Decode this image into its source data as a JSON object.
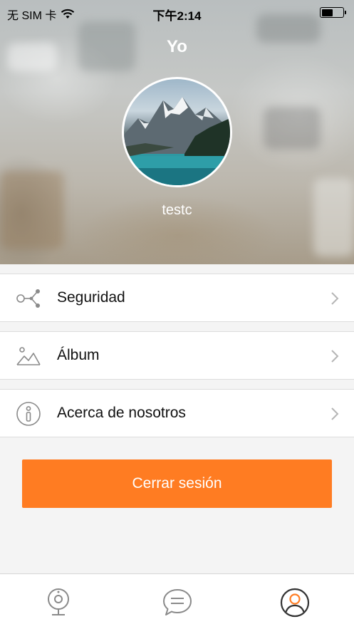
{
  "status_bar": {
    "carrier": "无 SIM 卡",
    "time": "下午2:14",
    "wifi_icon": "wifi-icon",
    "battery_level": 0.55
  },
  "header": {
    "title": "Yo",
    "username": "testc",
    "avatar": "mountain-lake-avatar"
  },
  "menu": {
    "items": [
      {
        "label": "Seguridad",
        "icon": "share-nodes-icon"
      },
      {
        "label": "Álbum",
        "icon": "landscape-image-icon"
      },
      {
        "label": "Acerca de nosotros",
        "icon": "info-icon"
      }
    ]
  },
  "logout": {
    "label": "Cerrar sesión"
  },
  "tabbar": {
    "tabs": [
      {
        "icon": "camera-icon",
        "active": false
      },
      {
        "icon": "chat-icon",
        "active": false
      },
      {
        "icon": "profile-icon",
        "active": true
      }
    ]
  },
  "colors": {
    "accent": "#ff7c22",
    "icon_gray": "#8a8a8a",
    "chevron_gray": "#b5b5b5",
    "background": "#f4f4f4"
  }
}
